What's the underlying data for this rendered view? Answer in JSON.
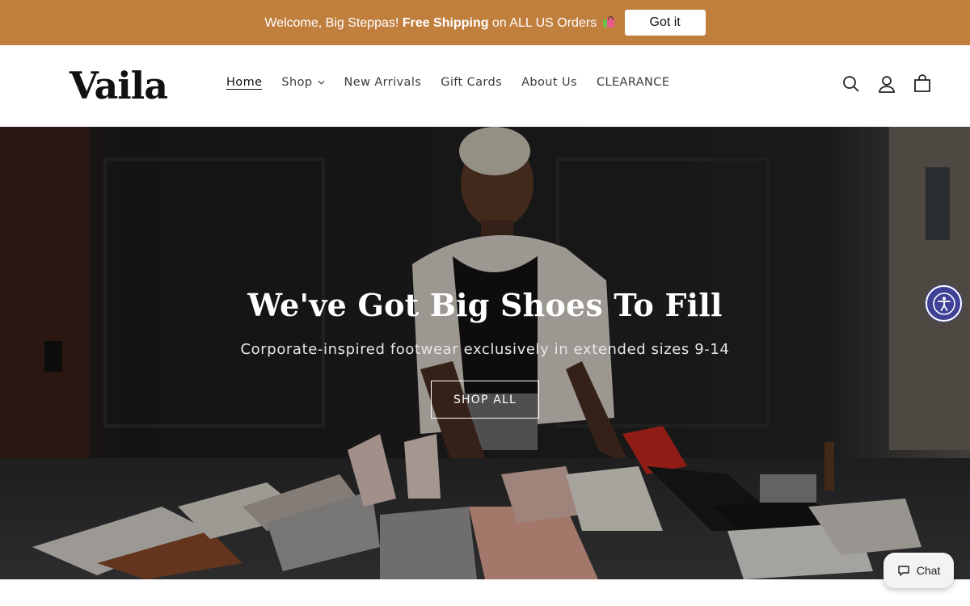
{
  "announcement": {
    "prefix": "Welcome, Big Steppas! ",
    "bold": "Free Shipping",
    "suffix": " on ALL US Orders",
    "emoji_icon": "shopping-bags-icon",
    "button_label": "Got it",
    "bg_color": "#c17f3e"
  },
  "header": {
    "logo": "Vaila",
    "nav": [
      {
        "label": "Home",
        "active": true
      },
      {
        "label": "Shop",
        "has_dropdown": true
      },
      {
        "label": "New Arrivals"
      },
      {
        "label": "Gift Cards"
      },
      {
        "label": "About Us"
      },
      {
        "label": "CLEARANCE"
      }
    ],
    "icons": [
      "search-icon",
      "account-icon",
      "cart-icon"
    ]
  },
  "hero": {
    "title": "We've Got Big Shoes To Fill",
    "subtitle": "Corporate-inspired footwear exclusively in extended sizes 9-14",
    "button_label": "SHOP ALL"
  },
  "floating": {
    "accessibility_icon": "accessibility-icon",
    "accessibility_color": "#3f4196",
    "chat_label": "Chat",
    "chat_icon": "chat-bubble-icon"
  }
}
